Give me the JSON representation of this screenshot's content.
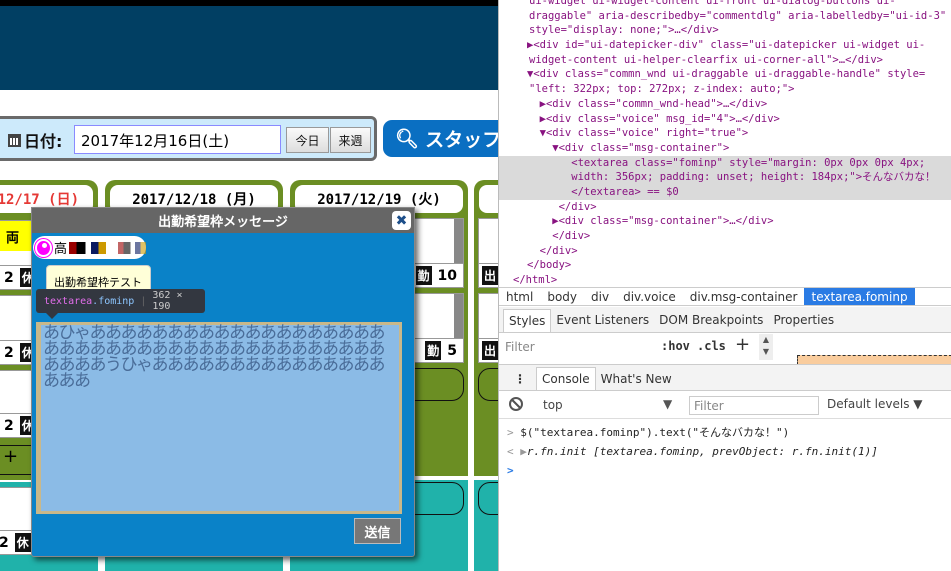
{
  "toolbar": {
    "date_label": "日付:",
    "date_value": "2017年12月16日(土)",
    "today_button": "今日",
    "next_week_button": "来週",
    "search_button": "スタッフ"
  },
  "calendar": {
    "days": [
      {
        "label": "12/17 (日)",
        "color": "#e53935"
      },
      {
        "label": "2017/12/18 (月)",
        "color": "#111111"
      },
      {
        "label": "2017/12/19 (火)",
        "color": "#111111"
      }
    ],
    "col1": {
      "top_cell": "両　員",
      "rows": [
        {
          "num": "2",
          "kind": "休"
        },
        {
          "num": "2",
          "kind": "休"
        },
        {
          "num": "2",
          "kind": "休"
        },
        {
          "num": "2",
          "kind": "休"
        }
      ],
      "add_label": "+"
    },
    "col3": {
      "rows": [
        {
          "kind": "勤",
          "num": "10"
        },
        {
          "kind": "勤",
          "num": "5"
        }
      ]
    },
    "col4": {
      "rows": [
        {
          "kind": "出"
        },
        {
          "kind": "出"
        }
      ]
    }
  },
  "dialog": {
    "title": "出勤希望枠メッセージ",
    "close": "✖",
    "user_name": "高",
    "message": "出勤希望枠テスト",
    "tooltip_tag": "textarea",
    "tooltip_class": ".fominp",
    "tooltip_size": "362 × 190",
    "textarea_value": "あひゃあああああああああああああああああああああああああああああああああああああああああああああうひゃああああああああああああああああああ",
    "send_button": "送信"
  },
  "devtools": {
    "elements_lines": [
      "ui-widget ui-widget-content ui-front ui-dialog-buttons ui-",
      "draggable\" aria-describedby=\"commentdlg\" aria-labelledby=\"ui-id-3\"",
      "style=\"display: none;\">…</div>",
      "▶<div id=\"ui-datepicker-div\" class=\"ui-datepicker ui-widget ui-",
      "widget-content ui-helper-clearfix ui-corner-all\">…</div>",
      "▼<div class=\"commn_wnd ui-draggable ui-draggable-handle\" style=",
      "\"left: 322px; top: 272px; z-index: auto;\">",
      "  ▶<div class=\"commn_wnd-head\">…</div>",
      "  ▶<div class=\"voice\" msg_id=\"4\">…</div>",
      "  ▼<div class=\"voice\" right=\"true\">",
      "    ▼<div class=\"msg-container\">",
      "       <textarea class=\"fominp\" style=\"margin: 0px 0px 0px 4px;",
      "       width: 356px; padding: unset; height: 184px;\">そんなバカな！",
      "       </textarea> == $0",
      "     </div>",
      "    ▶<div class=\"msg-container\">…</div>",
      "    </div>",
      "  </div>",
      "</body>",
      "</html>"
    ],
    "breadcrumbs": [
      "html",
      "body",
      "div",
      "div.voice",
      "div.msg-container",
      "textarea.fominp"
    ],
    "style_tabs": [
      "Styles",
      "Event Listeners",
      "DOM Breakpoints",
      "Properties"
    ],
    "styles_filter_placeholder": "Filter",
    "hov": ":hov",
    "cls": ".cls",
    "add": "+",
    "drawer_tabs": [
      "Console",
      "What's New"
    ],
    "context": "top",
    "console_filter_placeholder": "Filter",
    "levels": "Default levels ▼",
    "console_input": "$(\"textarea.fominp\").text(\"そんなバカな！\")",
    "console_output": "r.fn.init [textarea.fominp, prevObject: r.fn.init(1)]",
    "prompt": ">"
  }
}
